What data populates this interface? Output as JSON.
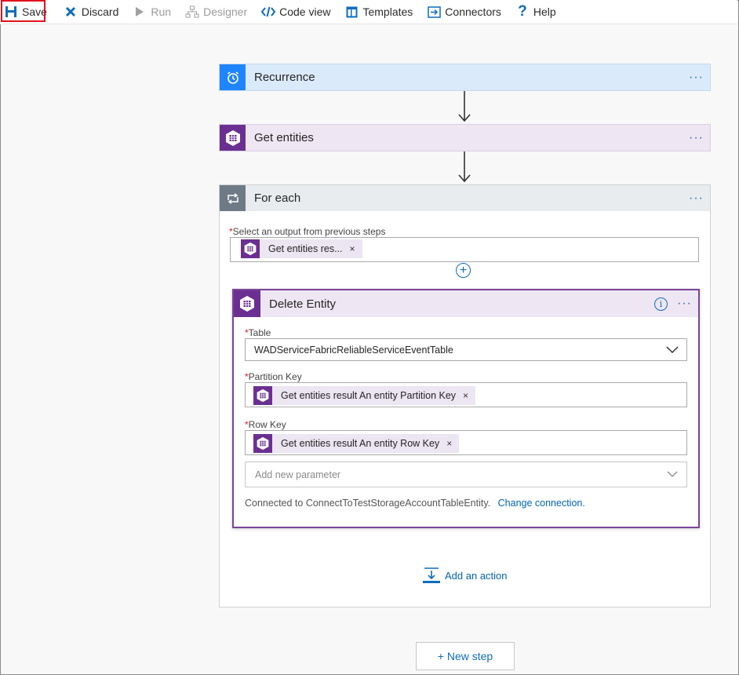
{
  "toolbar": {
    "save": "Save",
    "discard": "Discard",
    "run": "Run",
    "designer": "Designer",
    "code_view": "Code view",
    "templates": "Templates",
    "connectors": "Connectors",
    "help": "Help"
  },
  "steps": {
    "recurrence": {
      "title": "Recurrence",
      "menu": "···",
      "color": "#dbeafb",
      "icon_color": "#1f85ff"
    },
    "get_entities": {
      "title": "Get entities",
      "menu": "···",
      "color": "#eee6f2",
      "icon_color": "#6b2f91"
    },
    "for_each": {
      "title": "For each",
      "menu": "···",
      "icon_color": "#6e7a86",
      "header_color": "#e9ecef",
      "select_label": "Select an output from previous steps",
      "required_mark": "*",
      "token": "Get entities res...",
      "token_remove": "×",
      "add_button": "+",
      "add_action": "Add an action"
    },
    "delete_entity": {
      "title": "Delete Entity",
      "menu": "···",
      "info": "i",
      "border_color": "#7b4599",
      "table_label": "Table",
      "table_value": "WADServiceFabricReliableServiceEventTable",
      "partition_label": "Partition Key",
      "partition_token": "Get entities result An entity Partition Key",
      "row_label": "Row Key",
      "row_token": "Get entities result An entity Row Key",
      "token_remove": "×",
      "add_param_placeholder": "Add new parameter",
      "connection_text": "Connected to ConnectToTestStorageAccountTableEntity.",
      "change_connection": "Change connection."
    }
  },
  "new_step": "+ New step"
}
